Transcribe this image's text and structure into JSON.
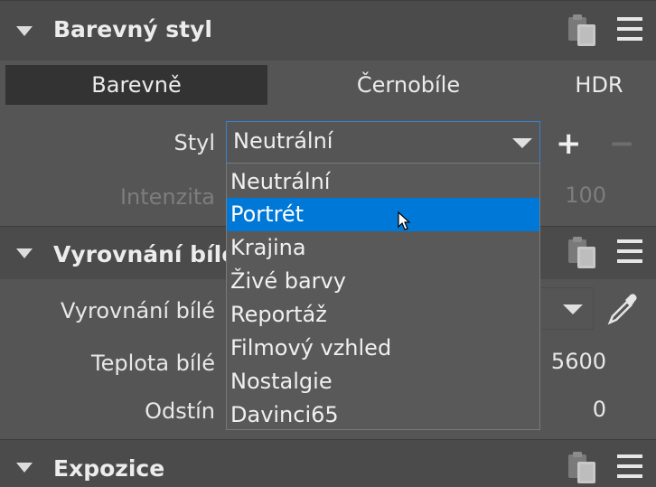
{
  "sections": {
    "color_style": {
      "title": "Barevný styl"
    },
    "white_balance": {
      "title": "Vyrovnání bílé"
    },
    "exposure": {
      "title": "Expozice"
    }
  },
  "tabs": [
    {
      "label": "Barevně",
      "active": true
    },
    {
      "label": "Černobíle",
      "active": false
    },
    {
      "label": "HDR",
      "active": false
    }
  ],
  "style_row": {
    "label": "Styl",
    "selected_value": "Neutrální",
    "add_symbol": "+",
    "remove_symbol": "−"
  },
  "intensity_row": {
    "label": "Intenzita",
    "value": "100"
  },
  "dropdown": {
    "options": [
      "Neutrální",
      "Portrét",
      "Krajina",
      "Živé barvy",
      "Reportáž",
      "Filmový vzhled",
      "Nostalgie",
      "Davinci65"
    ],
    "highlighted_index": 1
  },
  "wb_rows": {
    "mode_label": "Vyrovnání bílé",
    "temperature_label": "Teplota bílé",
    "temperature_value": "5600",
    "tint_label": "Odstín",
    "tint_value": "0"
  },
  "icons": {
    "clipboard": "clipboard-icon",
    "menu": "hamburger-menu-icon",
    "picker": "eyedropper-icon",
    "collapse": "triangle-down-icon"
  },
  "colors": {
    "accent": "#0078d7",
    "focus_border": "#3b7fcc",
    "panel_bg": "#555555",
    "header_bg": "#4b4b4b"
  }
}
